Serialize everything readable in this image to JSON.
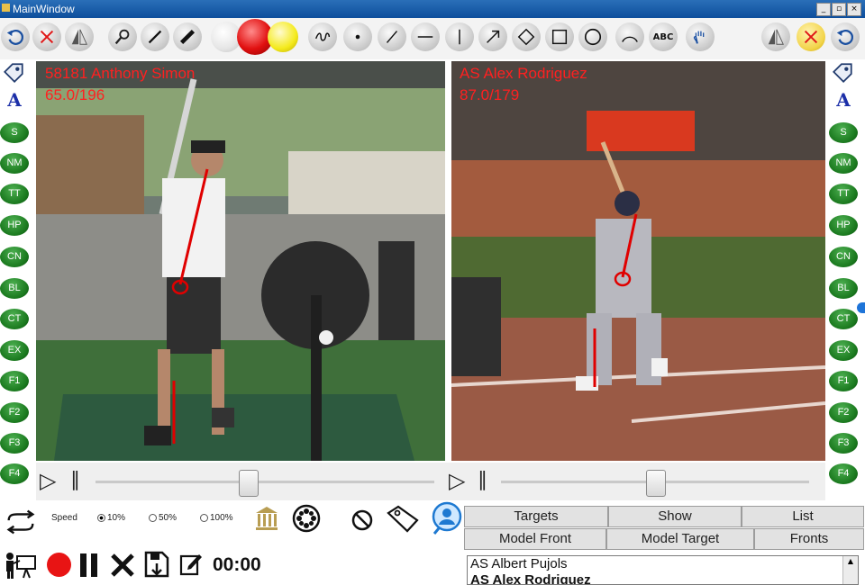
{
  "window": {
    "title": "MainWindow",
    "controls": [
      "_",
      "▫",
      "×"
    ]
  },
  "toolbar": {
    "left_tools": [
      "undo-icon",
      "clear-icon",
      "mirror-icon",
      "magnifier-icon",
      "pen-thin-icon",
      "pen-thick-icon"
    ],
    "colors": [
      "#ffffff",
      "#e11010",
      "#f4ea1c"
    ],
    "draw_tools": [
      "freehand-icon",
      "dot-icon",
      "line-icon",
      "horizontal-line-icon",
      "vertical-line-icon",
      "arrow-icon",
      "angle-icon",
      "rectangle-icon",
      "circle-icon",
      "arc-icon",
      "text-tool",
      "hand-icon"
    ],
    "text_tool_label": "ABC",
    "right_tools": [
      "mirror-icon",
      "clear-icon",
      "undo-icon"
    ]
  },
  "sidebar": {
    "buttons": [
      "S",
      "NM",
      "TT",
      "HP",
      "CN",
      "BL",
      "CT",
      "EX",
      "F1",
      "F2",
      "F3",
      "F4"
    ],
    "text_label": "A"
  },
  "left_video": {
    "line1": "58181 Anthony Simon",
    "line2": "65.0/196"
  },
  "right_video": {
    "line1": "AS Alex Rodriguez",
    "line2": "87.0/179"
  },
  "timeline": {
    "play_icon": "▷",
    "pause_icon": "∥",
    "left_pos": 0.45,
    "right_pos": 0.5
  },
  "controls": {
    "speed_label": "Speed",
    "speed_options": [
      "10%",
      "50%",
      "100%"
    ],
    "selected_speed": "10%",
    "timer": "00:00",
    "record_color": "#e81414"
  },
  "tabs": {
    "row1": [
      "Targets",
      "Show",
      "List"
    ],
    "row2": [
      "Model Front",
      "Model Target",
      "Fronts"
    ]
  },
  "models": [
    "AS Albert Pujols",
    "AS Alex Rodriguez"
  ]
}
